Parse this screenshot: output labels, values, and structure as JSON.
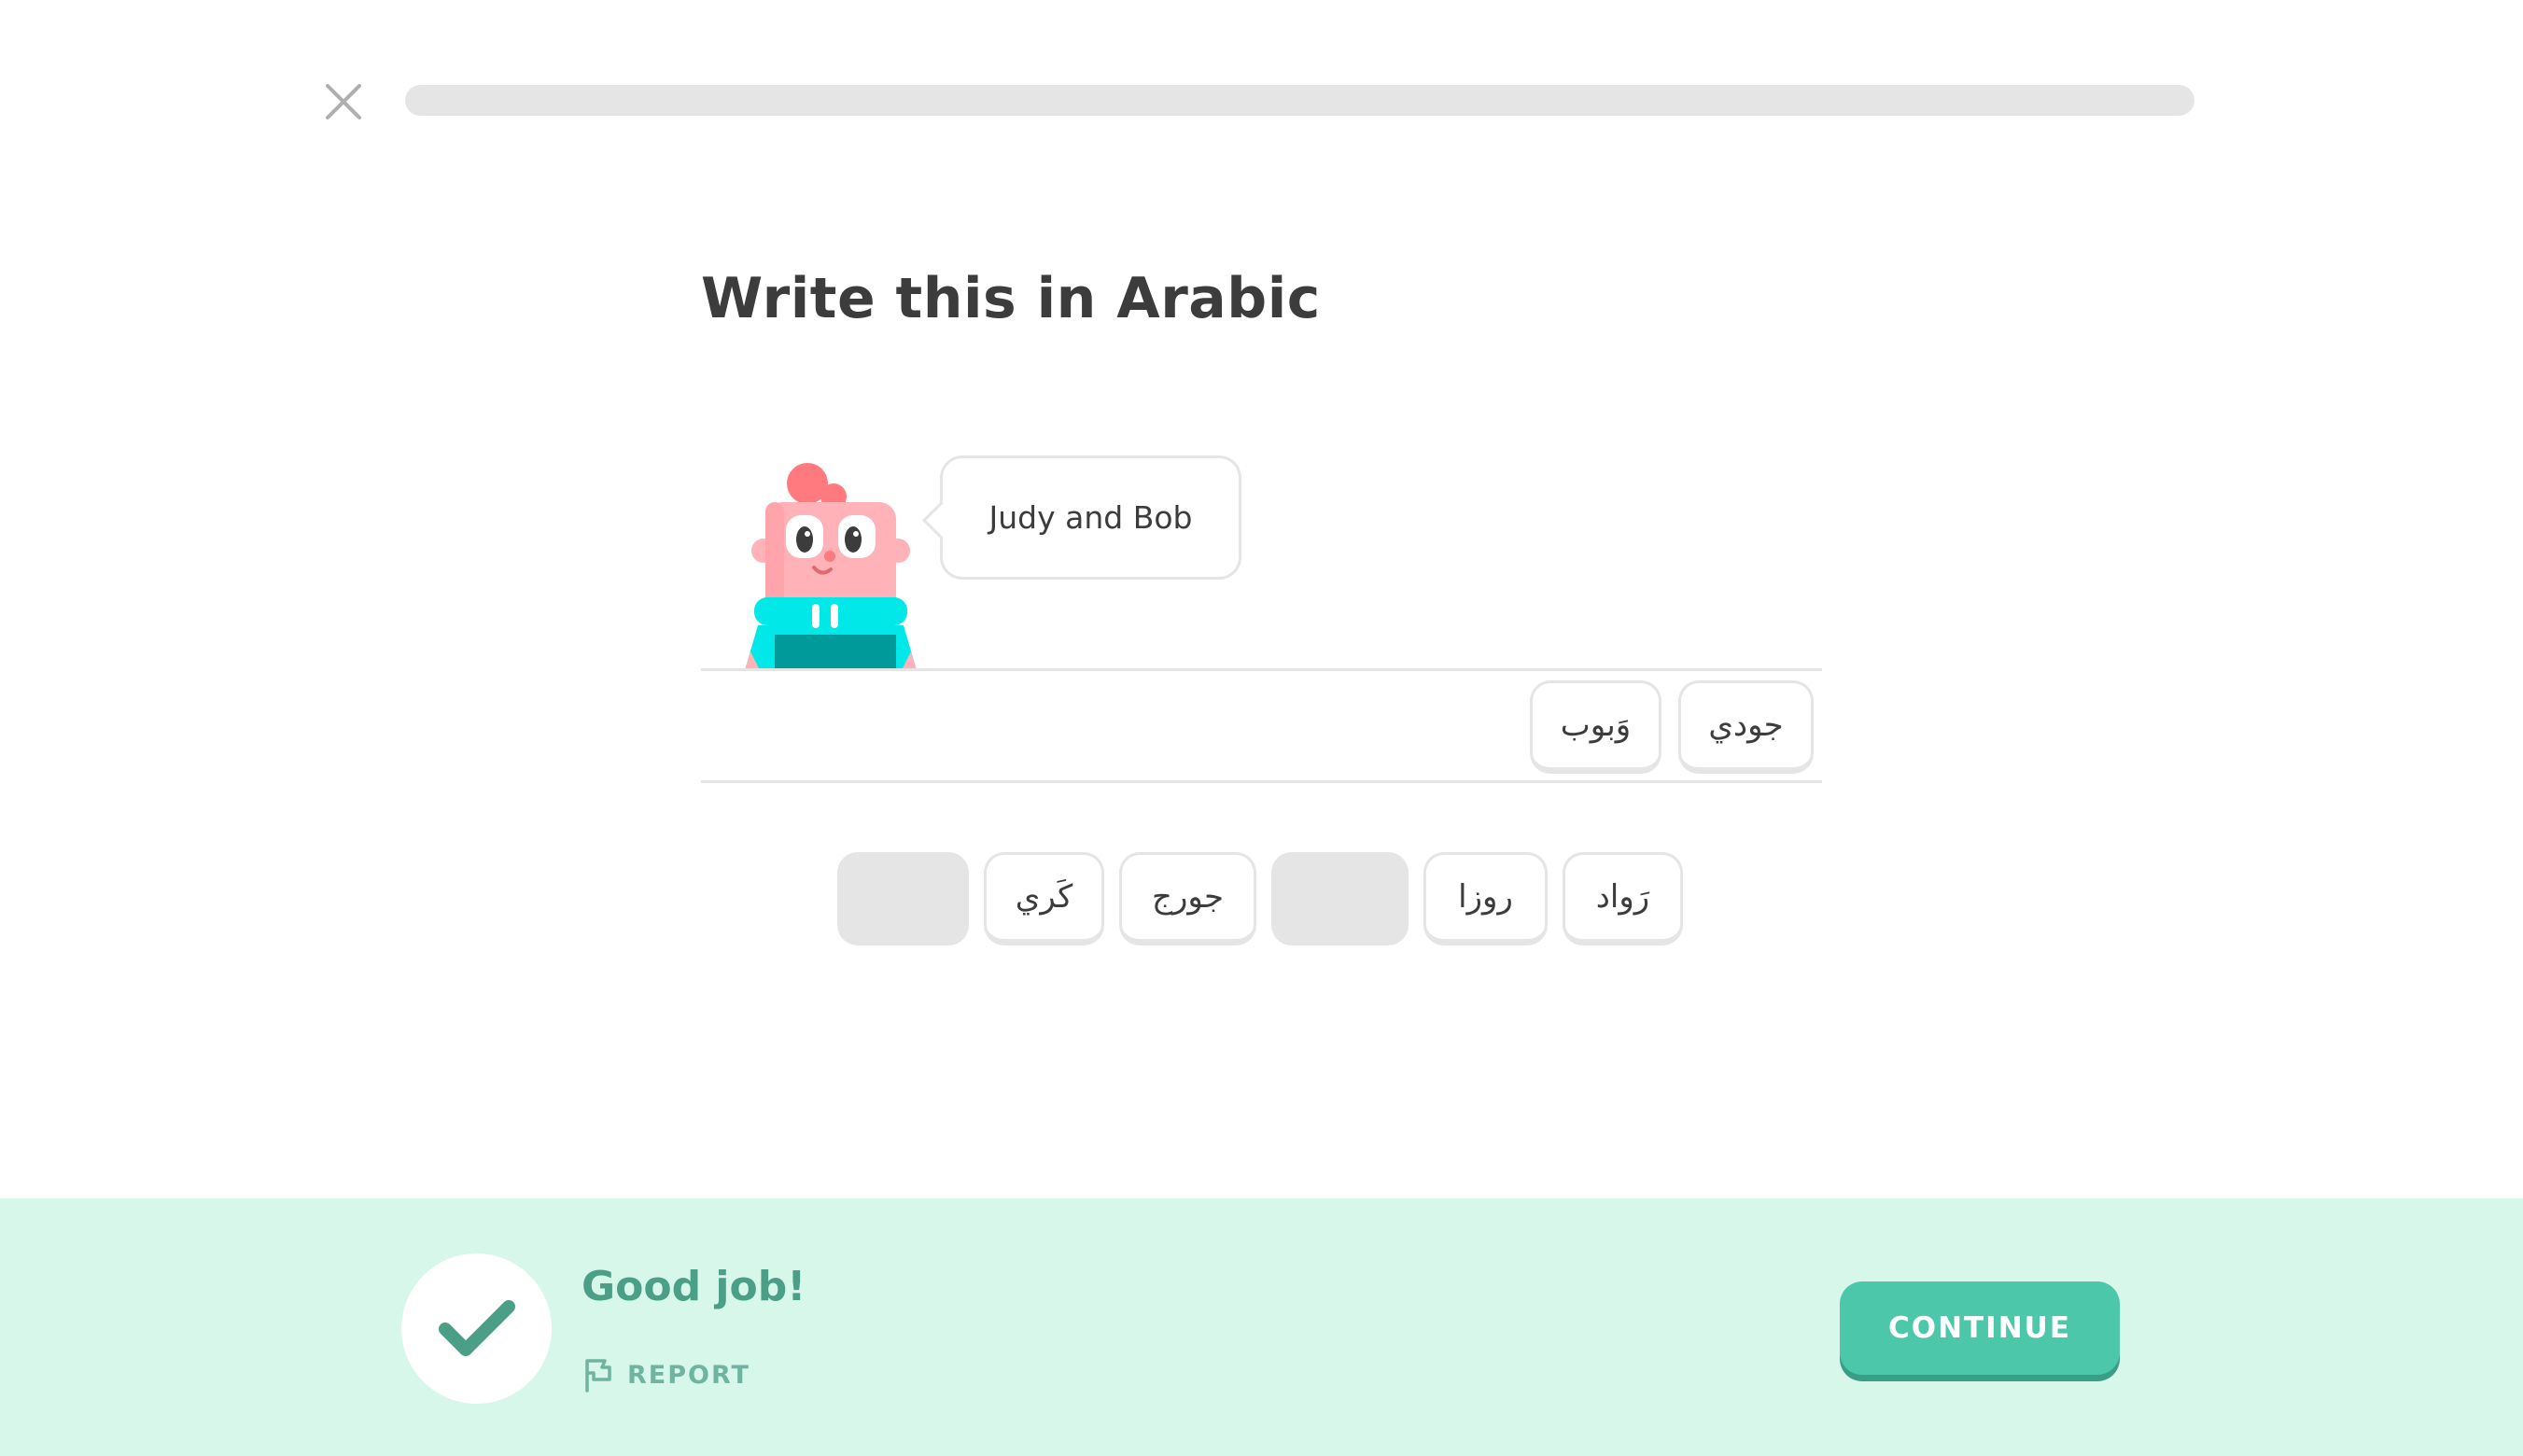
{
  "header": {
    "close_icon": "close-x-icon",
    "progress": {
      "fraction": 0.0,
      "track_color": "#e5e5e5",
      "fill_color": "#58cc02"
    }
  },
  "challenge": {
    "title": "Write this in Arabic",
    "speech_text": "Judy and Bob",
    "character_icon": "pink-character-illustration"
  },
  "answer": {
    "tiles": [
      {
        "label": "جودي"
      },
      {
        "label": "وَبوب"
      }
    ]
  },
  "word_bank": {
    "tiles": [
      {
        "label": "رَواد",
        "used": false
      },
      {
        "label": "روزا",
        "used": false
      },
      {
        "label": "",
        "used": true
      },
      {
        "label": "جورج",
        "used": false
      },
      {
        "label": "كَري",
        "used": false
      },
      {
        "label": "",
        "used": true
      }
    ]
  },
  "footer": {
    "background_color": "#d7f7eb",
    "check_icon": "checkmark-icon",
    "feedback_title": "Good job!",
    "report_icon": "flag-icon",
    "report_label": "REPORT",
    "continue_label": "CONTINUE",
    "accent_color": "#4cc7aa"
  }
}
